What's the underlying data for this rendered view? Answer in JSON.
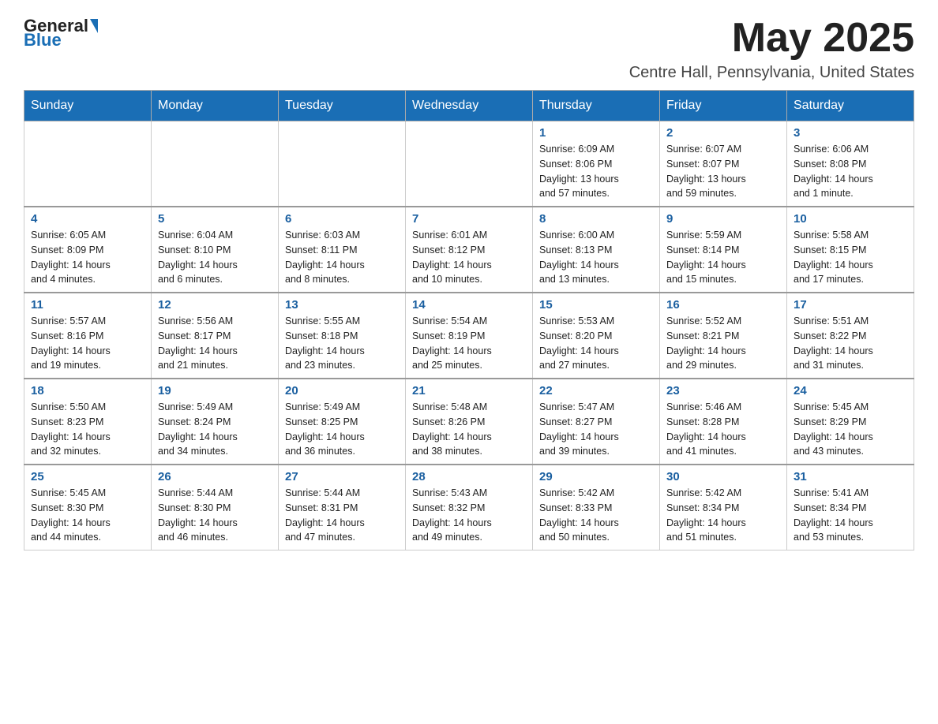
{
  "header": {
    "logo_general": "General",
    "logo_blue": "Blue",
    "month": "May 2025",
    "location": "Centre Hall, Pennsylvania, United States"
  },
  "days_of_week": [
    "Sunday",
    "Monday",
    "Tuesday",
    "Wednesday",
    "Thursday",
    "Friday",
    "Saturday"
  ],
  "weeks": [
    [
      {
        "day": "",
        "info": ""
      },
      {
        "day": "",
        "info": ""
      },
      {
        "day": "",
        "info": ""
      },
      {
        "day": "",
        "info": ""
      },
      {
        "day": "1",
        "info": "Sunrise: 6:09 AM\nSunset: 8:06 PM\nDaylight: 13 hours\nand 57 minutes."
      },
      {
        "day": "2",
        "info": "Sunrise: 6:07 AM\nSunset: 8:07 PM\nDaylight: 13 hours\nand 59 minutes."
      },
      {
        "day": "3",
        "info": "Sunrise: 6:06 AM\nSunset: 8:08 PM\nDaylight: 14 hours\nand 1 minute."
      }
    ],
    [
      {
        "day": "4",
        "info": "Sunrise: 6:05 AM\nSunset: 8:09 PM\nDaylight: 14 hours\nand 4 minutes."
      },
      {
        "day": "5",
        "info": "Sunrise: 6:04 AM\nSunset: 8:10 PM\nDaylight: 14 hours\nand 6 minutes."
      },
      {
        "day": "6",
        "info": "Sunrise: 6:03 AM\nSunset: 8:11 PM\nDaylight: 14 hours\nand 8 minutes."
      },
      {
        "day": "7",
        "info": "Sunrise: 6:01 AM\nSunset: 8:12 PM\nDaylight: 14 hours\nand 10 minutes."
      },
      {
        "day": "8",
        "info": "Sunrise: 6:00 AM\nSunset: 8:13 PM\nDaylight: 14 hours\nand 13 minutes."
      },
      {
        "day": "9",
        "info": "Sunrise: 5:59 AM\nSunset: 8:14 PM\nDaylight: 14 hours\nand 15 minutes."
      },
      {
        "day": "10",
        "info": "Sunrise: 5:58 AM\nSunset: 8:15 PM\nDaylight: 14 hours\nand 17 minutes."
      }
    ],
    [
      {
        "day": "11",
        "info": "Sunrise: 5:57 AM\nSunset: 8:16 PM\nDaylight: 14 hours\nand 19 minutes."
      },
      {
        "day": "12",
        "info": "Sunrise: 5:56 AM\nSunset: 8:17 PM\nDaylight: 14 hours\nand 21 minutes."
      },
      {
        "day": "13",
        "info": "Sunrise: 5:55 AM\nSunset: 8:18 PM\nDaylight: 14 hours\nand 23 minutes."
      },
      {
        "day": "14",
        "info": "Sunrise: 5:54 AM\nSunset: 8:19 PM\nDaylight: 14 hours\nand 25 minutes."
      },
      {
        "day": "15",
        "info": "Sunrise: 5:53 AM\nSunset: 8:20 PM\nDaylight: 14 hours\nand 27 minutes."
      },
      {
        "day": "16",
        "info": "Sunrise: 5:52 AM\nSunset: 8:21 PM\nDaylight: 14 hours\nand 29 minutes."
      },
      {
        "day": "17",
        "info": "Sunrise: 5:51 AM\nSunset: 8:22 PM\nDaylight: 14 hours\nand 31 minutes."
      }
    ],
    [
      {
        "day": "18",
        "info": "Sunrise: 5:50 AM\nSunset: 8:23 PM\nDaylight: 14 hours\nand 32 minutes."
      },
      {
        "day": "19",
        "info": "Sunrise: 5:49 AM\nSunset: 8:24 PM\nDaylight: 14 hours\nand 34 minutes."
      },
      {
        "day": "20",
        "info": "Sunrise: 5:49 AM\nSunset: 8:25 PM\nDaylight: 14 hours\nand 36 minutes."
      },
      {
        "day": "21",
        "info": "Sunrise: 5:48 AM\nSunset: 8:26 PM\nDaylight: 14 hours\nand 38 minutes."
      },
      {
        "day": "22",
        "info": "Sunrise: 5:47 AM\nSunset: 8:27 PM\nDaylight: 14 hours\nand 39 minutes."
      },
      {
        "day": "23",
        "info": "Sunrise: 5:46 AM\nSunset: 8:28 PM\nDaylight: 14 hours\nand 41 minutes."
      },
      {
        "day": "24",
        "info": "Sunrise: 5:45 AM\nSunset: 8:29 PM\nDaylight: 14 hours\nand 43 minutes."
      }
    ],
    [
      {
        "day": "25",
        "info": "Sunrise: 5:45 AM\nSunset: 8:30 PM\nDaylight: 14 hours\nand 44 minutes."
      },
      {
        "day": "26",
        "info": "Sunrise: 5:44 AM\nSunset: 8:30 PM\nDaylight: 14 hours\nand 46 minutes."
      },
      {
        "day": "27",
        "info": "Sunrise: 5:44 AM\nSunset: 8:31 PM\nDaylight: 14 hours\nand 47 minutes."
      },
      {
        "day": "28",
        "info": "Sunrise: 5:43 AM\nSunset: 8:32 PM\nDaylight: 14 hours\nand 49 minutes."
      },
      {
        "day": "29",
        "info": "Sunrise: 5:42 AM\nSunset: 8:33 PM\nDaylight: 14 hours\nand 50 minutes."
      },
      {
        "day": "30",
        "info": "Sunrise: 5:42 AM\nSunset: 8:34 PM\nDaylight: 14 hours\nand 51 minutes."
      },
      {
        "day": "31",
        "info": "Sunrise: 5:41 AM\nSunset: 8:34 PM\nDaylight: 14 hours\nand 53 minutes."
      }
    ]
  ]
}
